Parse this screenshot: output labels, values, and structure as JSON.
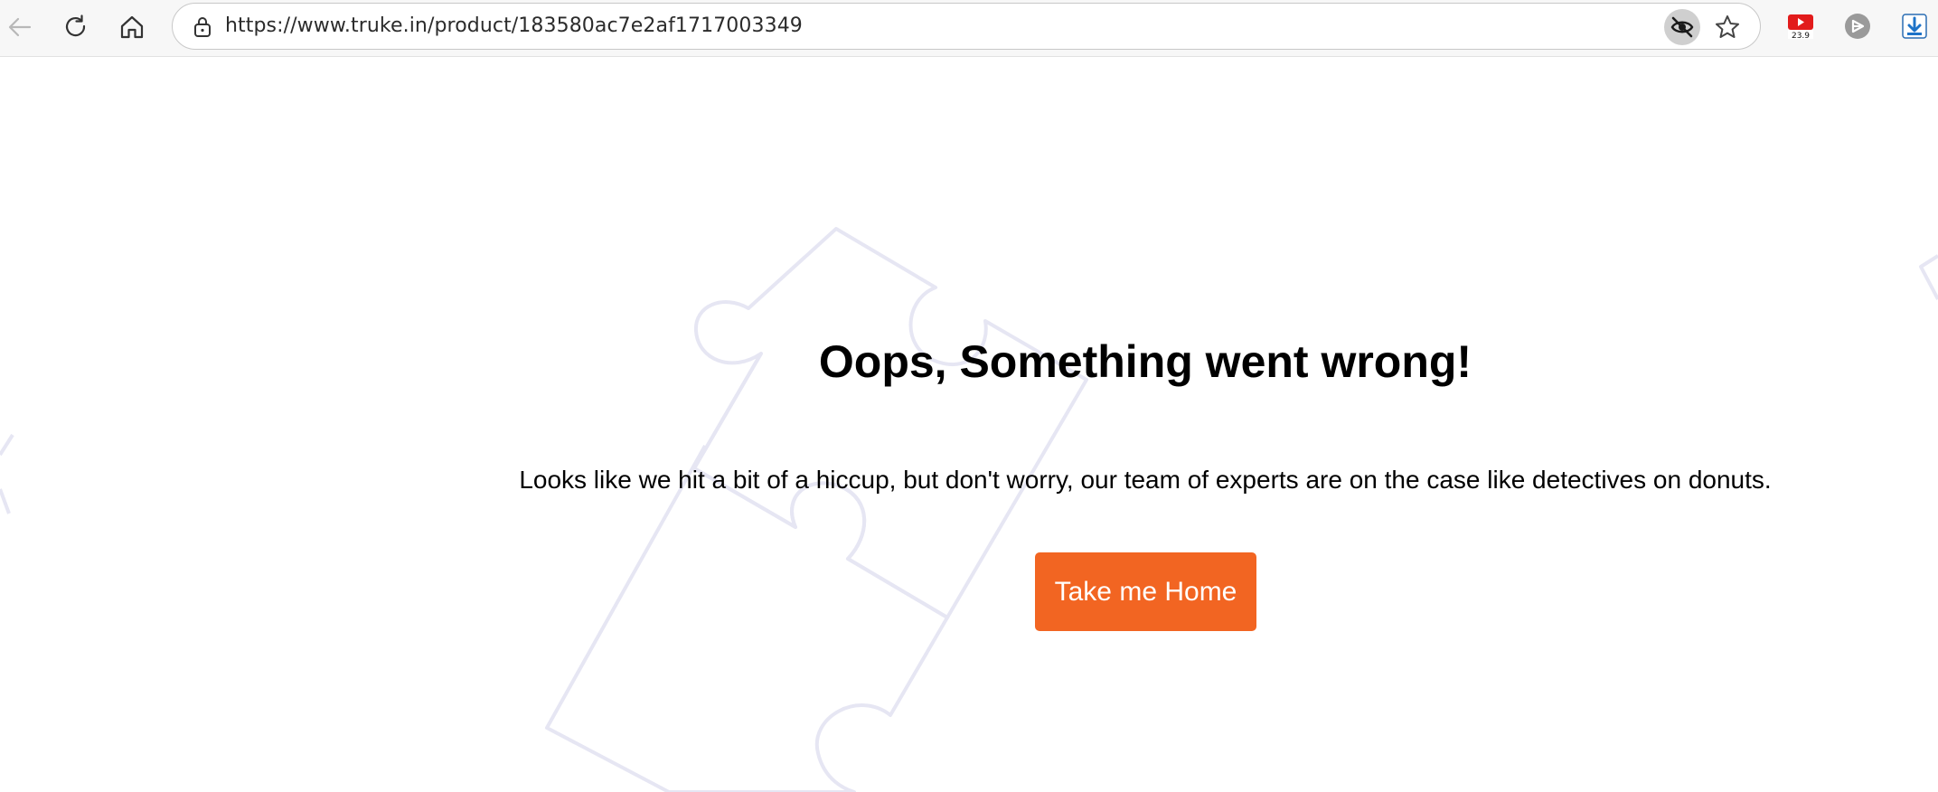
{
  "browser": {
    "url": "https://www.truke.in/product/183580ac7e2af1717003349",
    "nav": {
      "back_icon": "back-arrow-icon",
      "reload_icon": "reload-icon",
      "home_icon": "home-icon"
    },
    "omnibox_icons": [
      "lock-icon",
      "eye-slash-icon",
      "star-icon"
    ],
    "extensions": [
      {
        "name": "youtube-extension-icon",
        "badge": "23.9"
      },
      {
        "name": "circle-extension-icon"
      },
      {
        "name": "download-extension-icon"
      }
    ]
  },
  "error_page": {
    "title": "Oops, Something went wrong!",
    "description": "Looks like we hit a bit of a hiccup, but don't worry, our team of experts are on the case like detectives on donuts.",
    "home_button": "Take me Home"
  },
  "colors": {
    "accent": "#f26522",
    "puzzle_outline": "#e6e6f3",
    "text": "#000000"
  }
}
